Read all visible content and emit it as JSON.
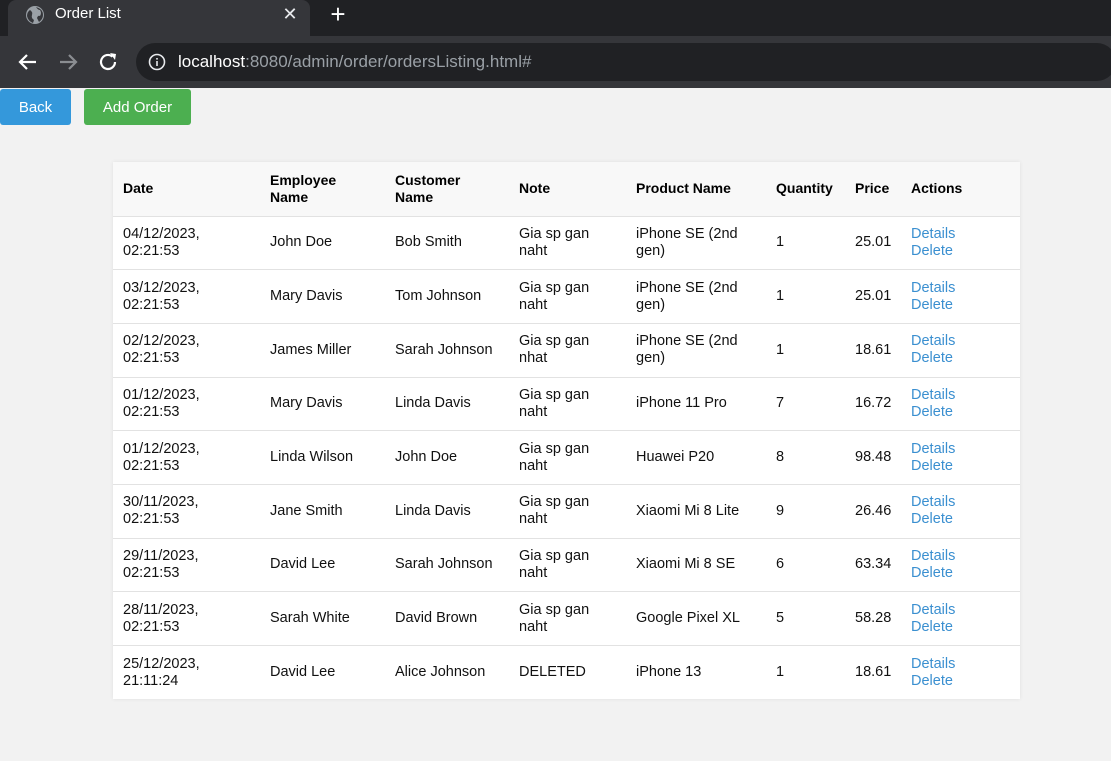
{
  "browser": {
    "tab_title": "Order List",
    "url_host": "localhost",
    "url_rest": ":8080/admin/order/ordersListing.html#",
    "icons": [
      "globe-icon",
      "close-icon",
      "plus-icon",
      "back-arrow-icon",
      "forward-arrow-icon",
      "reload-icon",
      "info-icon"
    ]
  },
  "toolbar": {
    "back_label": "Back",
    "add_label": "Add Order"
  },
  "table": {
    "headers": {
      "date": "Date",
      "employee": "Employee Name",
      "customer": "Customer Name",
      "note": "Note",
      "product": "Product Name",
      "quantity": "Quantity",
      "price": "Price",
      "actions": "Actions"
    },
    "details_label": "Details",
    "delete_label": "Delete",
    "rows": [
      {
        "date": "04/12/2023, 02:21:53",
        "employee": "John Doe",
        "customer": "Bob Smith",
        "note": "Gia sp gan naht",
        "product": "iPhone SE (2nd gen)",
        "quantity": "1",
        "price": "25.01"
      },
      {
        "date": "03/12/2023, 02:21:53",
        "employee": "Mary Davis",
        "customer": "Tom Johnson",
        "note": "Gia sp gan naht",
        "product": "iPhone SE (2nd gen)",
        "quantity": "1",
        "price": "25.01"
      },
      {
        "date": "02/12/2023, 02:21:53",
        "employee": "James Miller",
        "customer": "Sarah Johnson",
        "note": "Gia sp gan nhat",
        "product": "iPhone SE (2nd gen)",
        "quantity": "1",
        "price": "18.61"
      },
      {
        "date": "01/12/2023, 02:21:53",
        "employee": "Mary Davis",
        "customer": "Linda Davis",
        "note": "Gia sp gan naht",
        "product": "iPhone 11 Pro",
        "quantity": "7",
        "price": "16.72"
      },
      {
        "date": "01/12/2023, 02:21:53",
        "employee": "Linda Wilson",
        "customer": "John Doe",
        "note": "Gia sp gan naht",
        "product": "Huawei P20",
        "quantity": "8",
        "price": "98.48"
      },
      {
        "date": "30/11/2023, 02:21:53",
        "employee": "Jane Smith",
        "customer": "Linda Davis",
        "note": "Gia sp gan naht",
        "product": "Xiaomi Mi 8 Lite",
        "quantity": "9",
        "price": "26.46"
      },
      {
        "date": "29/11/2023, 02:21:53",
        "employee": "David Lee",
        "customer": "Sarah Johnson",
        "note": "Gia sp gan naht",
        "product": "Xiaomi Mi 8 SE",
        "quantity": "6",
        "price": "63.34"
      },
      {
        "date": "28/11/2023, 02:21:53",
        "employee": "Sarah White",
        "customer": "David Brown",
        "note": "Gia sp gan naht",
        "product": "Google Pixel XL",
        "quantity": "5",
        "price": "58.28"
      },
      {
        "date": "25/12/2023, 21:11:24",
        "employee": "David Lee",
        "customer": "Alice Johnson",
        "note": "DELETED",
        "product": "iPhone 13",
        "quantity": "1",
        "price": "18.61"
      }
    ]
  },
  "colors": {
    "back_button": "#3498db",
    "add_button": "#4caf50",
    "link": "#3a8fd0",
    "page_bg": "#f2f2f2",
    "chrome_dark": "#202124",
    "chrome_tab": "#35363a"
  }
}
